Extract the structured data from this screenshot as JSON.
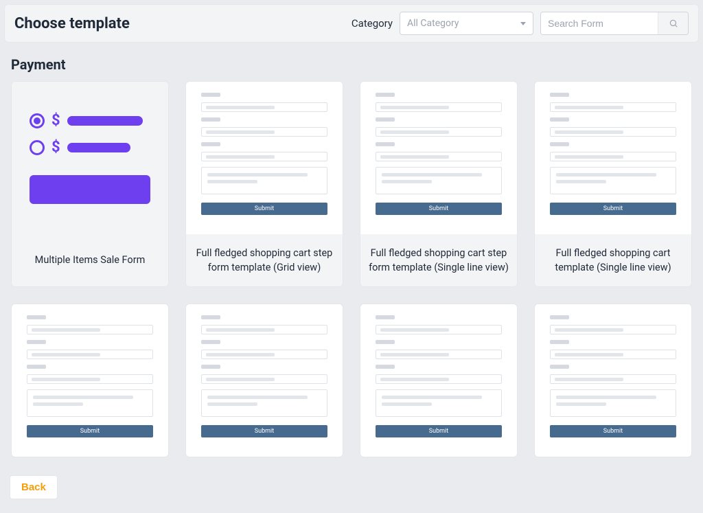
{
  "header": {
    "title": "Choose template",
    "category_label": "Category",
    "category_placeholder": "All Category",
    "search_placeholder": "Search Form"
  },
  "section": {
    "title": "Payment"
  },
  "templates": [
    {
      "label": "Multiple Items Sale Form"
    },
    {
      "label": "Full fledged shopping cart step form template (Grid view)"
    },
    {
      "label": "Full fledged shopping cart step form template (Single line view)"
    },
    {
      "label": "Full fledged shopping cart template (Single line view)"
    }
  ],
  "thumb": {
    "submit": "Submit"
  },
  "footer": {
    "back": "Back"
  }
}
